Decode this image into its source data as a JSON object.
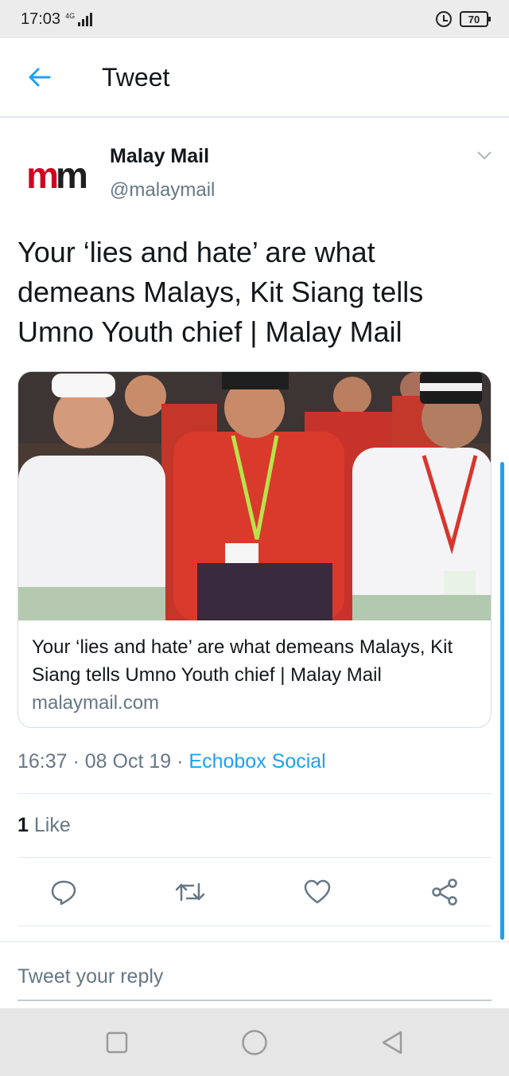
{
  "status_bar": {
    "time": "17:03",
    "network": "4G",
    "battery": "70"
  },
  "app_bar": {
    "title": "Tweet"
  },
  "tweet": {
    "author_name": "Malay Mail",
    "author_handle": "@malaymail",
    "avatar_text": "mm",
    "text": "Your ‘lies and hate’ are what demeans Malays, Kit Siang tells Umno Youth chief | Malay Mail",
    "card": {
      "title": "Your ‘lies and hate’ are what demeans Malays, Kit Siang tells Umno Youth chief | Malay Mail",
      "domain": "malaymail.com"
    },
    "time": "16:37",
    "date": "08 Oct 19",
    "source": "Echobox Social",
    "like_count": "1",
    "like_label": "Like"
  },
  "reply": {
    "placeholder": "Tweet your reply"
  },
  "colors": {
    "accent": "#1da1f2",
    "secondary_text": "#657786",
    "brand_red": "#d2001f"
  },
  "icons": [
    "back-arrow-icon",
    "chevron-down-icon",
    "reply-icon",
    "retweet-icon",
    "like-icon",
    "share-icon",
    "alarm-icon",
    "battery-icon",
    "signal-icon"
  ]
}
